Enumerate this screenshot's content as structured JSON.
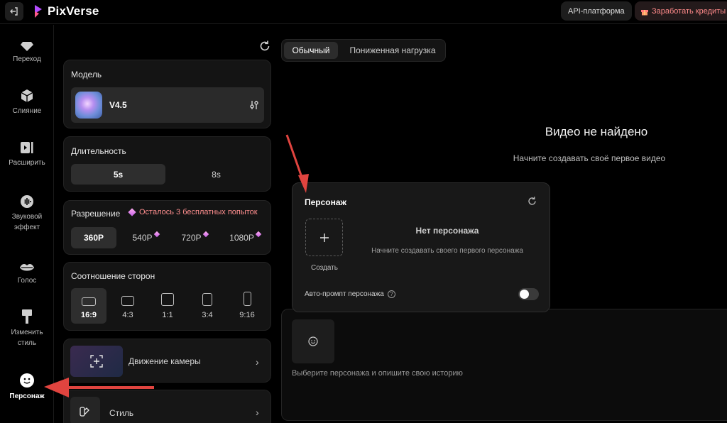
{
  "brand": {
    "name": "PixVerse"
  },
  "header": {
    "api_label": "API-платформа",
    "earn_label": "Заработать кредиты"
  },
  "sidebar": {
    "items": [
      {
        "label": "Переход",
        "icon": "diamond-icon"
      },
      {
        "label": "Слияние",
        "icon": "cube-icon"
      },
      {
        "label": "Расширить",
        "icon": "extend-video-icon"
      },
      {
        "label": "Звуковой эффект",
        "icon": "sound-wave-icon"
      },
      {
        "label": "Голос",
        "icon": "lips-icon"
      },
      {
        "label": "Изменить стиль",
        "icon": "brush-icon"
      },
      {
        "label": "Персонаж",
        "icon": "smile-icon",
        "active": true
      }
    ]
  },
  "settings": {
    "model": {
      "title": "Модель",
      "name": "V4.5"
    },
    "duration": {
      "title": "Длительность",
      "options": [
        "5s",
        "8s"
      ],
      "selected": "5s"
    },
    "resolution": {
      "title": "Разрешение",
      "note": "Осталось 3 бесплатных попыток",
      "options": [
        "360P",
        "540P",
        "720P",
        "1080P"
      ],
      "selected": "360P"
    },
    "aspect": {
      "title": "Соотношение сторон",
      "options": [
        "16:9",
        "4:3",
        "1:1",
        "3:4",
        "9:16"
      ],
      "selected": "16:9"
    },
    "camera": {
      "label": "Движение камеры"
    },
    "style": {
      "label": "Стиль"
    }
  },
  "tabs": {
    "normal": "Обычный",
    "low": "Пониженная нагрузка",
    "selected": "normal"
  },
  "empty_state": {
    "title": "Видео не найдено",
    "subtitle": "Начните создавать своё первое видео"
  },
  "character_popup": {
    "title": "Персонаж",
    "create_label": "Создать",
    "no_character": "Нет персонажа",
    "no_character_hint": "Начните создавать своего первого персонажа",
    "auto_prompt_label": "Авто-промпт персонажа",
    "auto_prompt_on": false
  },
  "prompt": {
    "placeholder": "Выберите персонажа и опишите свою историю"
  },
  "colors": {
    "accent_red": "#e0443f",
    "note_pink": "#ff8f8f",
    "background": "#000000"
  }
}
